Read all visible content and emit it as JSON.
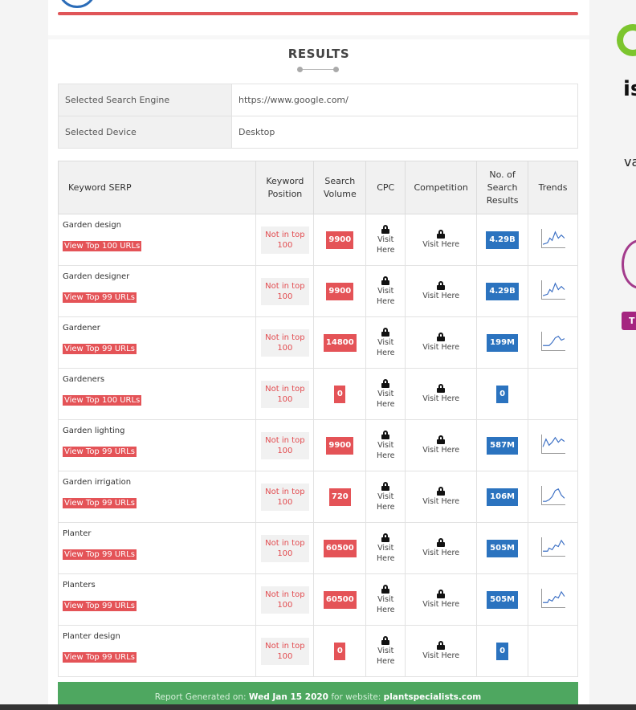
{
  "results_title": "RESULTS",
  "info": [
    {
      "label": "Selected Search Engine",
      "value": "https://www.google.com/"
    },
    {
      "label": "Selected Device",
      "value": "Desktop"
    }
  ],
  "columns": [
    "Keyword SERP",
    "Keyword Position",
    "Search Volume",
    "CPC",
    "Competition",
    "No. of Search Results",
    "Trends"
  ],
  "cpc_text": "Visit Here",
  "competition_text": "Visit Here",
  "rows": [
    {
      "keyword": "Garden design",
      "link": "View Top 100 URLs",
      "position": "Not in top 100",
      "volume": "9900",
      "results": "4.29B",
      "trend": "up-wave"
    },
    {
      "keyword": "Garden designer",
      "link": "View Top 99 URLs",
      "position": "Not in top 100",
      "volume": "9900",
      "results": "4.29B",
      "trend": "up-wave"
    },
    {
      "keyword": "Gardener",
      "link": "View Top 99 URLs",
      "position": "Not in top 100",
      "volume": "14800",
      "results": "199M",
      "trend": "hump"
    },
    {
      "keyword": "Gardeners",
      "link": "View Top 100 URLs",
      "position": "Not in top 100",
      "volume": "0",
      "results": "0",
      "trend": ""
    },
    {
      "keyword": "Garden lighting",
      "link": "View Top 99 URLs",
      "position": "Not in top 100",
      "volume": "9900",
      "results": "587M",
      "trend": "zigzag"
    },
    {
      "keyword": "Garden irrigation",
      "link": "View Top 99 URLs",
      "position": "Not in top 100",
      "volume": "720",
      "results": "106M",
      "trend": "peak"
    },
    {
      "keyword": "Planter",
      "link": "View Top 99 URLs",
      "position": "Not in top 100",
      "volume": "60500",
      "results": "505M",
      "trend": "step"
    },
    {
      "keyword": "Planters",
      "link": "View Top 99 URLs",
      "position": "Not in top 100",
      "volume": "60500",
      "results": "505M",
      "trend": "step"
    },
    {
      "keyword": "Planter design",
      "link": "View Top 99 URLs",
      "position": "Not in top 100",
      "volume": "0",
      "results": "0",
      "trend": ""
    }
  ],
  "footer": {
    "prefix": "Report Generated on: ",
    "date": "Wed Jan 15 2020",
    "middle": " for website: ",
    "site": "plantspecialists.com"
  },
  "side": {
    "is": "is",
    "va": "va",
    "t": "T"
  },
  "colors": {
    "red": "#e45357",
    "blue": "#2b73bf",
    "green": "#4ea760"
  }
}
